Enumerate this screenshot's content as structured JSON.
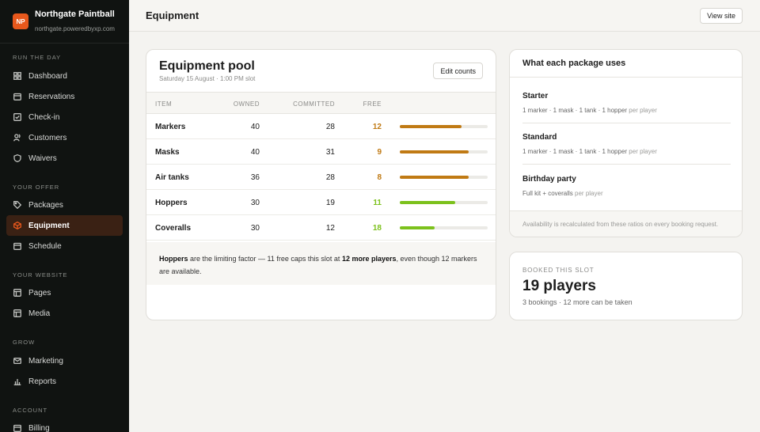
{
  "brand": {
    "initials": "NP",
    "name": "Northgate Paintball",
    "url": "northgate.poweredbyxp.com"
  },
  "nav": {
    "sections": {
      "run": "RUN THE DAY",
      "offer": "YOUR OFFER",
      "website": "YOUR WEBSITE",
      "grow": "GROW",
      "account": "ACCOUNT"
    },
    "items": {
      "dashboard": "Dashboard",
      "reservations": "Reservations",
      "checkin": "Check-in",
      "customers": "Customers",
      "waivers": "Waivers",
      "packages": "Packages",
      "equipment": "Equipment",
      "schedule": "Schedule",
      "pages": "Pages",
      "media": "Media",
      "marketing": "Marketing",
      "reports": "Reports",
      "billing": "Billing"
    },
    "active": "equipment"
  },
  "header": {
    "title": "Equipment",
    "view_site": "View site"
  },
  "pool": {
    "title": "Equipment pool",
    "subtitle": "Saturday 15 August · 1:00 PM slot",
    "edit_label": "Edit counts",
    "columns": {
      "item": "ITEM",
      "owned": "OWNED",
      "committed": "COMMITTED",
      "free": "FREE"
    },
    "rows": [
      {
        "item": "Markers",
        "owned": "40",
        "committed": "28",
        "free": "12",
        "fill": 0.7,
        "color": "#c07a14"
      },
      {
        "item": "Masks",
        "owned": "40",
        "committed": "31",
        "free": "9",
        "fill": 0.78,
        "color": "#c07a14"
      },
      {
        "item": "Air tanks",
        "owned": "36",
        "committed": "28",
        "free": "8",
        "fill": 0.78,
        "color": "#c07a14"
      },
      {
        "item": "Hoppers",
        "owned": "30",
        "committed": "19",
        "free": "11",
        "fill": 0.63,
        "color": "#7cc11c"
      },
      {
        "item": "Coveralls",
        "owned": "30",
        "committed": "12",
        "free": "18",
        "fill": 0.4,
        "color": "#7cc11c"
      }
    ],
    "note": {
      "strong1": "Hoppers",
      "text1": " are the limiting factor — 11 free caps this slot at ",
      "strong2": "12 more players",
      "text2": ", even though 12 markers are available."
    }
  },
  "packages": {
    "title": "What each package uses",
    "items": [
      {
        "name": "Starter",
        "desc": "1 marker · 1 mask · 1 tank · 1 hopper",
        "per": "per player"
      },
      {
        "name": "Standard",
        "desc": "1 marker · 1 mask · 1 tank · 1 hopper",
        "per": "per player"
      },
      {
        "name": "Birthday party",
        "desc": "Full kit + coveralls",
        "per": "per player"
      }
    ],
    "footer": "Availability is recalculated from these ratios on every booking request."
  },
  "booked": {
    "label": "BOOKED THIS SLOT",
    "count": "19 players",
    "sub": "3 bookings · 12 more can be taken"
  }
}
